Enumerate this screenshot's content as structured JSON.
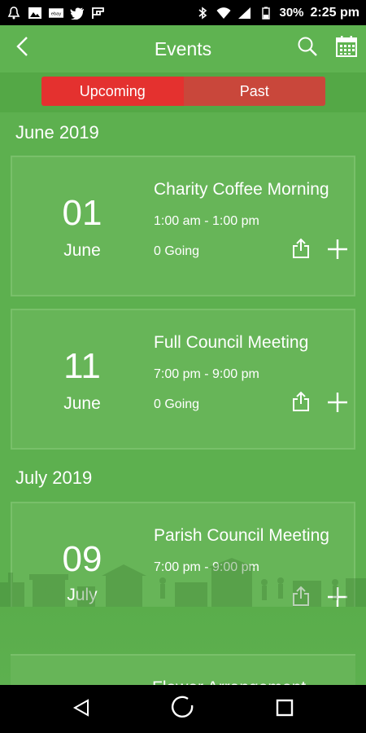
{
  "status_bar": {
    "icons": [
      "notification-bell-icon",
      "image-icon",
      "ebay-icon",
      "twitter-icon",
      "flipboard-icon",
      "bluetooth-icon",
      "wifi-icon",
      "signal-icon",
      "battery-icon"
    ],
    "ebay_label": "ebay",
    "battery": "30%",
    "time": "2:25 pm"
  },
  "app_bar": {
    "title": "Events",
    "back_icon": "chevron-left-icon",
    "search_icon": "search-icon",
    "calendar_icon": "calendar-icon"
  },
  "tabs": {
    "upcoming": "Upcoming",
    "past": "Past",
    "active": "upcoming",
    "colors": {
      "active": "#e4312f",
      "inactive": "#c9473b"
    }
  },
  "sections": [
    {
      "month": "June 2019",
      "events": [
        {
          "day": "01",
          "month": "June",
          "title": "Charity Coffee Morning",
          "time": "1:00 am - 1:00 pm",
          "going": "0 Going"
        },
        {
          "day": "11",
          "month": "June",
          "title": "Full Council Meeting",
          "time": "7:00 pm - 9:00 pm",
          "going": "0 Going"
        }
      ]
    },
    {
      "month": "July 2019",
      "events": [
        {
          "day": "09",
          "month": "July",
          "title": "Parish Council Meeting",
          "time": "7:00 pm - 9:00 pm",
          "going": ""
        },
        {
          "day": "",
          "month": "",
          "title": "Flower Arrangement",
          "time": "",
          "going": ""
        }
      ]
    }
  ],
  "nav_bar": {
    "icons": [
      "back-triangle-icon",
      "home-circle-icon",
      "recents-square-icon"
    ]
  },
  "theme": {
    "primary": "#5db04f",
    "card": "#67b558"
  }
}
